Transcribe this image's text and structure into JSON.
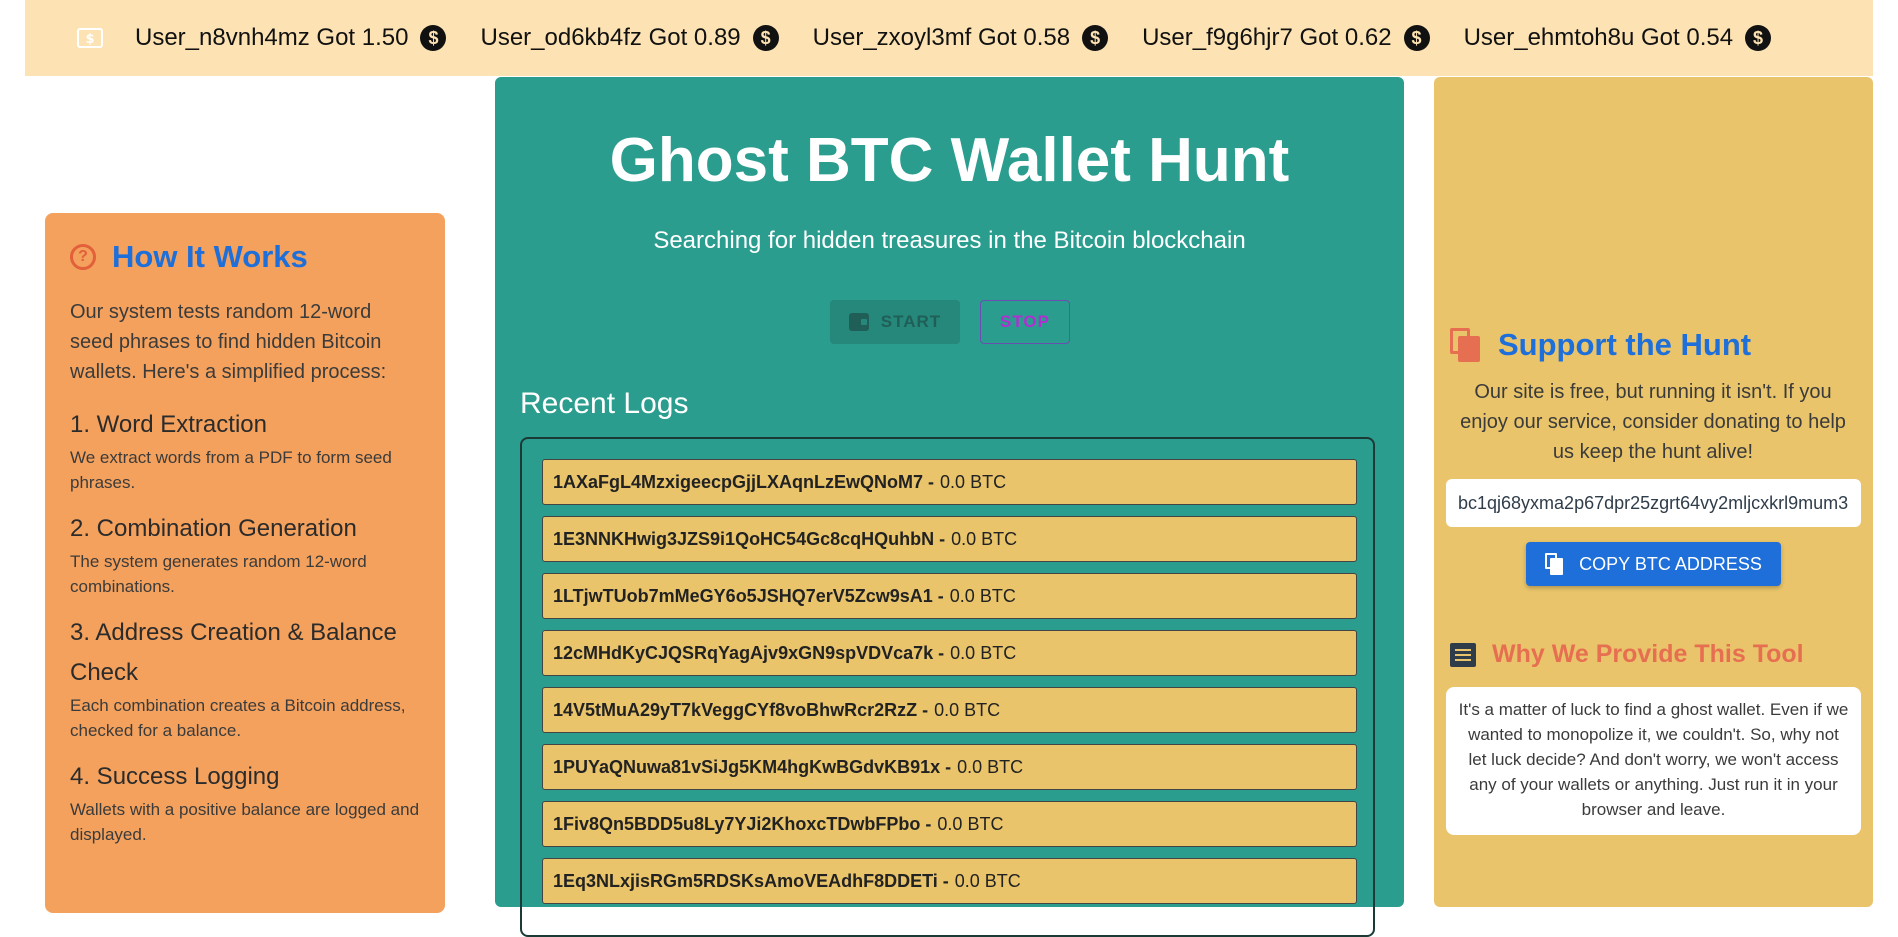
{
  "ticker": {
    "items": [
      {
        "text": "User_n8vnh4mz Got 1.50"
      },
      {
        "text": "User_od6kb4fz Got 0.89"
      },
      {
        "text": "User_zxoyl3mf Got 0.58"
      },
      {
        "text": "User_f9g6hjr7 Got 0.62"
      },
      {
        "text": "User_ehmtoh8u Got 0.54"
      }
    ],
    "coin_glyph": "$"
  },
  "how_it_works": {
    "title": "How It Works",
    "icon_glyph": "?",
    "intro": "Our system tests random 12-word seed phrases to find hidden Bitcoin wallets. Here's a simplified process:",
    "steps": [
      {
        "title": "1. Word Extraction",
        "desc": "We extract words from a PDF to form seed phrases."
      },
      {
        "title": "2. Combination Generation",
        "desc": "The system generates random 12-word combinations."
      },
      {
        "title": "3. Address Creation & Balance Check",
        "desc": "Each combination creates a Bitcoin address, checked for a balance."
      },
      {
        "title": "4. Success Logging",
        "desc": "Wallets with a positive balance are logged and displayed."
      }
    ]
  },
  "main": {
    "title": "Ghost BTC Wallet Hunt",
    "subtitle": "Searching for hidden treasures in the Bitcoin blockchain",
    "start_label": "START",
    "stop_label": "STOP",
    "logs_title": "Recent Logs",
    "logs": [
      {
        "address": "1AXaFgL4MzxigeecpGjjLXAqnLzEwQNoM7 -",
        "balance": "0.0 BTC"
      },
      {
        "address": "1E3NNKHwig3JZS9i1QoHC54Gc8cqHQuhbN -",
        "balance": "0.0 BTC"
      },
      {
        "address": "1LTjwTUob7mMeGY6o5JSHQ7erV5Zcw9sA1 -",
        "balance": "0.0 BTC"
      },
      {
        "address": "12cMHdKyCJQSRqYagAjv9xGN9spVDVca7k -",
        "balance": "0.0 BTC"
      },
      {
        "address": "14V5tMuA29yT7kVeggCYf8voBhwRcr2RzZ -",
        "balance": "0.0 BTC"
      },
      {
        "address": "1PUYaQNuwa81vSiJg5KM4hgKwBGdvKB91x -",
        "balance": "0.0 BTC"
      },
      {
        "address": "1Fiv8Qn5BDD5u8Ly7YJi2KhoxcTDwbFPbo -",
        "balance": "0.0 BTC"
      },
      {
        "address": "1Eq3NLxjisRGm5RDSKsAmoVEAdhF8DDETi -",
        "balance": "0.0 BTC"
      }
    ]
  },
  "support": {
    "title": "Support the Hunt",
    "text": "Our site is free, but running it isn't. If you enjoy our service, consider donating to help us keep the hunt alive!",
    "address": "bc1qj68yxma2p67dpr25zgrt64vy2mljcxkrl9mum3",
    "copy_label": "COPY BTC ADDRESS"
  },
  "why": {
    "title": "Why We Provide This Tool",
    "text": "It's a matter of luck to find a ghost wallet. Even if we wanted to monopolize it, we couldn't. So, why not let luck decide? And don't worry, we won't access any of your wallets or anything. Just run it in your browser and leave."
  },
  "colors": {
    "ticker_bg": "#fde3b3",
    "left_card_bg": "#f3a15d",
    "center_card_bg": "#2a9d8f",
    "right_card_bg": "#e9c46a",
    "accent_blue": "#1e6fd9",
    "accent_orange": "#e76f51"
  }
}
